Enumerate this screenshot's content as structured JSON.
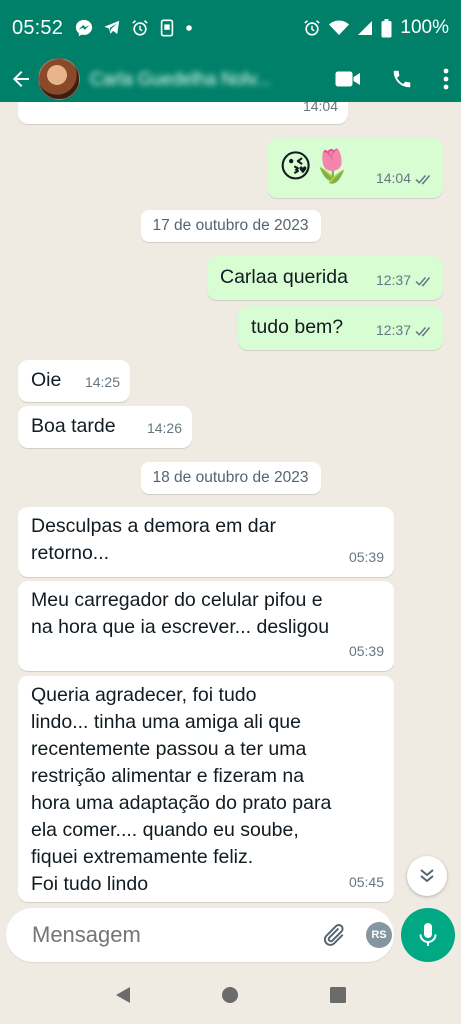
{
  "status_bar": {
    "time": "05:52",
    "battery_percent": "100%"
  },
  "header": {
    "contact_name": "Carla Guedelha Nolv...",
    "icons": [
      "back-arrow-icon",
      "video-call-icon",
      "voice-call-icon",
      "more-options-icon"
    ]
  },
  "messages": [
    {
      "type": "out",
      "time": "14:04",
      "status": "read",
      "emoji": "😘🌷"
    },
    {
      "type": "date",
      "text": "17 de outubro de 2023"
    },
    {
      "type": "out",
      "text": "Carlaa querida",
      "time": "12:37",
      "status": "read"
    },
    {
      "type": "out",
      "text": "tudo bem?",
      "time": "12:37",
      "status": "read"
    },
    {
      "type": "in",
      "text": "Oie",
      "time": "14:25"
    },
    {
      "type": "in",
      "text": "Boa tarde",
      "time": "14:26"
    },
    {
      "type": "date",
      "text": "18 de outubro de 2023"
    },
    {
      "type": "in",
      "text": "Desculpas a demora em dar\nretorno...",
      "time": "05:39"
    },
    {
      "type": "in",
      "text": "Meu carregador do celular pifou e\nna hora que ia escrever... desligou",
      "time": "05:39"
    },
    {
      "type": "in",
      "text": "Queria agradecer, foi tudo\nlindo... tinha uma amiga ali que\nrecentemente passou a ter uma\nrestrição alimentar e fizeram na\nhora uma adaptação do prato para\nela comer.... quando eu soube,\nfiquei extremamente feliz.\nFoi tudo lindo",
      "time": "05:45"
    }
  ],
  "partial_top_time": "14:04",
  "composer": {
    "placeholder": "Mensagem",
    "rs_badge": "RS"
  },
  "colors": {
    "header": "#008069",
    "outgoing": "#d9fdd3",
    "incoming": "#ffffff",
    "background": "#efeae2",
    "accent": "#00a884",
    "read_ticks": "#667781"
  }
}
